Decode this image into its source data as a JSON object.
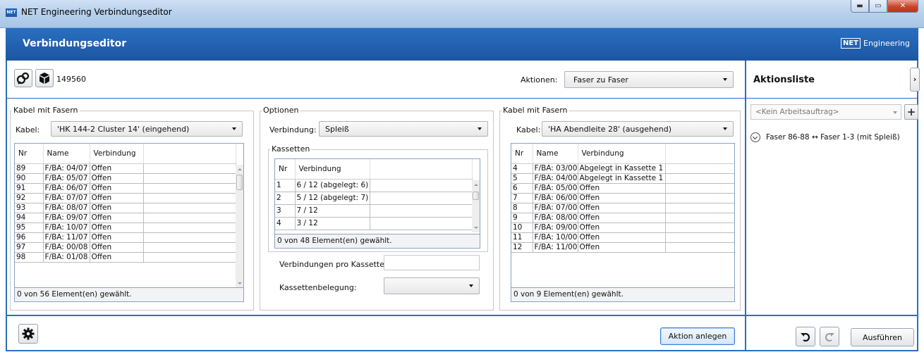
{
  "window": {
    "title": "NET Engineering Verbindungseditor",
    "icon": "NET"
  },
  "header": {
    "title": "Verbindungseditor",
    "brand_logo": "NET",
    "brand_name": "Engineering"
  },
  "toolbar": {
    "id": "149560",
    "aktionen_label": "Aktionen:",
    "aktionen_value": "Faser zu Faser"
  },
  "left": {
    "group_title": "Kabel mit Fasern",
    "kabel_label": "Kabel:",
    "kabel_value": "'HK 144-2 Cluster 14' (eingehend)",
    "columns": [
      "Nr",
      "Name",
      "Verbindung"
    ],
    "rows": [
      [
        "89",
        "F/BA: 04/07",
        "Offen"
      ],
      [
        "90",
        "F/BA: 05/07",
        "Offen"
      ],
      [
        "91",
        "F/BA: 06/07",
        "Offen"
      ],
      [
        "92",
        "F/BA: 07/07",
        "Offen"
      ],
      [
        "93",
        "F/BA: 08/07",
        "Offen"
      ],
      [
        "94",
        "F/BA: 09/07",
        "Offen"
      ],
      [
        "95",
        "F/BA: 10/07",
        "Offen"
      ],
      [
        "96",
        "F/BA: 11/07",
        "Offen"
      ],
      [
        "97",
        "F/BA: 00/08",
        "Offen"
      ],
      [
        "98",
        "F/BA: 01/08",
        "Offen"
      ]
    ],
    "footer": "0 von 56 Element(en) gewählt."
  },
  "middle": {
    "group_title": "Optionen",
    "verbindung_label": "Verbindung:",
    "verbindung_value": "Spleiß",
    "kassetten_title": "Kassetten",
    "columns": [
      "Nr",
      "Verbindung"
    ],
    "rows": [
      [
        "1",
        "6 / 12 (abgelegt: 6)"
      ],
      [
        "2",
        "5 / 12 (abgelegt: 7)"
      ],
      [
        "3",
        "7 / 12"
      ],
      [
        "4",
        "3 / 12"
      ]
    ],
    "footer": "0 von 48 Element(en) gewählt.",
    "pro_kassette_label": "Verbindungen pro Kassette:",
    "pro_kassette_value": "",
    "belegung_label": "Kassettenbelegung:",
    "belegung_value": ""
  },
  "right": {
    "group_title": "Kabel mit Fasern",
    "kabel_label": "Kabel:",
    "kabel_value": "'HA Abendleite 28' (ausgehend)",
    "columns": [
      "Nr",
      "Name",
      "Verbindung"
    ],
    "rows": [
      [
        "4",
        "F/BA: 03/00",
        "Abgelegt in Kassette 1"
      ],
      [
        "5",
        "F/BA: 04/00",
        "Abgelegt in Kassette 1"
      ],
      [
        "6",
        "F/BA: 05/00",
        "Offen"
      ],
      [
        "7",
        "F/BA: 06/00",
        "Offen"
      ],
      [
        "8",
        "F/BA: 07/00",
        "Offen"
      ],
      [
        "9",
        "F/BA: 08/00",
        "Offen"
      ],
      [
        "10",
        "F/BA: 09/00",
        "Offen"
      ],
      [
        "11",
        "F/BA: 10/00",
        "Offen"
      ],
      [
        "12",
        "F/BA: 11/00",
        "Offen"
      ]
    ],
    "footer": "0 von 9 Element(en) gewählt."
  },
  "aktionsliste": {
    "title": "Aktionsliste",
    "collapse_glyph": "›",
    "auftrag_placeholder": "<Kein Arbeitsauftrag>",
    "add_glyph": "+",
    "items": [
      "Faser 86-88 ↔ Faser 1-3 (mit Spleiß)"
    ]
  },
  "bottom": {
    "create_action": "Aktion anlegen",
    "execute": "Ausführen"
  },
  "icons": [
    "network-icon",
    "box-icon",
    "settings-icon",
    "undo-icon",
    "redo-icon"
  ],
  "colors": {
    "accent": "#2a6fc0",
    "header": "#1c56a2"
  }
}
